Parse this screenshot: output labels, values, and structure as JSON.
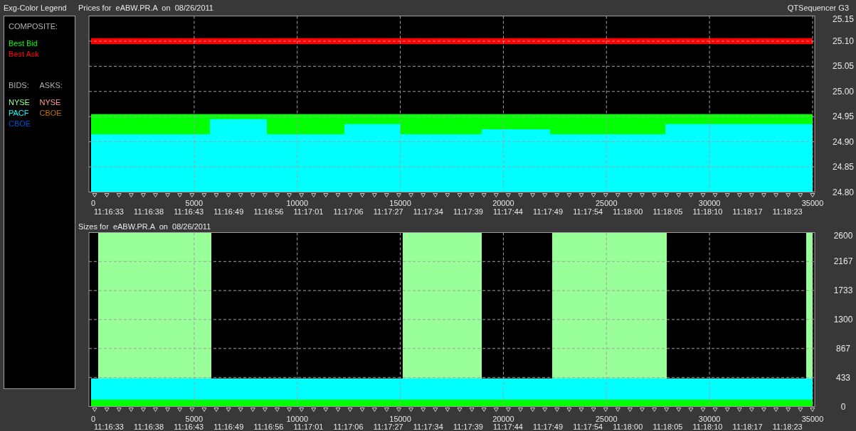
{
  "legend": {
    "title": "Exg-Color Legend",
    "composite_heading": "COMPOSITE:",
    "composite": [
      {
        "label": "Best Bid",
        "color": "#00ff00"
      },
      {
        "label": "Best Ask",
        "color": "#ff0000"
      }
    ],
    "bids_heading": "BIDS:",
    "asks_heading": "ASKS:",
    "bids": [
      {
        "label": "NYSE",
        "color": "#99ff99"
      },
      {
        "label": "PACF",
        "color": "#00ffff"
      },
      {
        "label": "CBOE",
        "color": "#0050c8"
      }
    ],
    "asks": [
      {
        "label": "NYSE",
        "color": "#ff9999"
      },
      {
        "label": "CBOE",
        "color": "#c07000"
      }
    ]
  },
  "app_title": "QTSequencer G3",
  "prices": {
    "chart_data": {
      "type": "area",
      "title": "Prices for  eABW.PR.A  on  08/26/2011",
      "x": [
        0,
        5765,
        8525,
        12290,
        15015,
        18950,
        22265,
        27855,
        35000
      ],
      "xlim": [
        0,
        35000
      ],
      "ylim": [
        24.8,
        25.15
      ],
      "xticks": [
        0,
        5000,
        10000,
        15000,
        20000,
        25000,
        30000,
        35000
      ],
      "yticks": [
        {
          "value": 24.8,
          "label": "24.80"
        },
        {
          "value": 24.85,
          "label": "24.85"
        },
        {
          "value": 24.9,
          "label": "24.90"
        },
        {
          "value": 24.95,
          "label": "24.95"
        },
        {
          "value": 25.0,
          "label": "25.00"
        },
        {
          "value": 25.05,
          "label": "25.05"
        },
        {
          "value": 25.1,
          "label": "25.10"
        },
        {
          "value": 25.15,
          "label": "25.15"
        }
      ],
      "grid": true,
      "bands": [
        {
          "axis": "y",
          "from": 25.094,
          "to": 25.106,
          "color": "#ff0000"
        }
      ],
      "series": [
        {
          "color": "#00ff00",
          "values": [
            24.955,
            24.955,
            24.955,
            24.955,
            24.955,
            24.955,
            24.955,
            24.955,
            24.955
          ]
        },
        {
          "color": "#00ffff",
          "values": [
            24.915,
            24.945,
            24.915,
            24.935,
            24.915,
            24.925,
            24.915,
            24.935,
            24.935
          ]
        }
      ]
    },
    "time_labels": [
      "11:16:33",
      "11:16:38",
      "11:16:43",
      "11:16:49",
      "11:16:56",
      "11:17:01",
      "11:17:06",
      "11:17:27",
      "11:17:34",
      "11:17:39",
      "11:17:44",
      "11:17:49",
      "11:17:54",
      "11:18:00",
      "11:18:05",
      "11:18:10",
      "11:18:17",
      "11:18:23"
    ]
  },
  "sizes": {
    "chart_data": {
      "type": "area",
      "title": "Sizes for  eABW.PR.A  on  08/26/2011",
      "x": [
        0,
        345,
        5834,
        15119,
        18951,
        22368,
        27926,
        34691,
        35000
      ],
      "xlim": [
        0,
        35000
      ],
      "ylim": [
        0,
        2600
      ],
      "xticks": [
        0,
        5000,
        10000,
        15000,
        20000,
        25000,
        30000,
        35000
      ],
      "yticks": [
        0,
        433,
        867,
        1300,
        1733,
        2167,
        2600
      ],
      "grid": true,
      "series": [
        {
          "color": "#99ff99",
          "values": [
            0,
            2600,
            0,
            2600,
            0,
            2600,
            0,
            2600,
            2600
          ]
        },
        {
          "color": "#00ffff",
          "values": [
            420,
            420,
            420,
            420,
            420,
            420,
            420,
            420,
            420
          ]
        },
        {
          "color": "#00ff00",
          "values": [
            100,
            100,
            100,
            100,
            100,
            100,
            100,
            100,
            100
          ]
        }
      ]
    },
    "time_labels": [
      "11:16:33",
      "11:16:38",
      "11:16:43",
      "11:16:49",
      "11:16:56",
      "11:17:01",
      "11:17:06",
      "11:17:27",
      "11:17:34",
      "11:17:39",
      "11:17:44",
      "11:17:49",
      "11:17:54",
      "11:18:00",
      "11:18:05",
      "11:18:10",
      "11:18:17",
      "11:18:23"
    ]
  }
}
